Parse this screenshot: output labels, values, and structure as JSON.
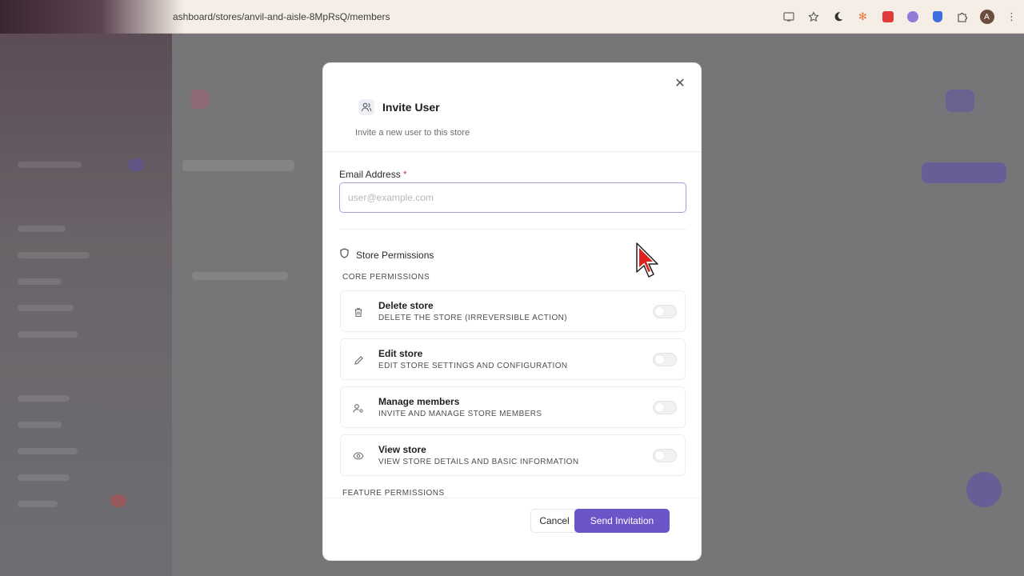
{
  "browser": {
    "url": "ashboard/stores/anvil-and-aisle-8MpRsQ/members",
    "profile_initial": "A",
    "icons": [
      "cast-icon",
      "star-icon",
      "moon-icon",
      "sparkle-icon",
      "download-icon",
      "circle-extension-icon",
      "shield-extension-icon",
      "puzzle-icon",
      "avatar",
      "kebab-menu-icon"
    ]
  },
  "modal": {
    "title": "Invite User",
    "subtitle": "Invite a new user to this store",
    "close_icon": "close-icon",
    "email": {
      "label": "Email Address",
      "required_mark": "*",
      "placeholder": "user@example.com",
      "value": ""
    },
    "permissions": {
      "section_title": "Store Permissions",
      "core_label": "CORE PERMISSIONS",
      "feature_label": "FEATURE PERMISSIONS",
      "core": [
        {
          "title": "Delete store",
          "description": "DELETE THE STORE (IRREVERSIBLE ACTION)",
          "icon": "trash-icon",
          "enabled": false
        },
        {
          "title": "Edit store",
          "description": "EDIT STORE SETTINGS AND CONFIGURATION",
          "icon": "pencil-icon",
          "enabled": false
        },
        {
          "title": "Manage members",
          "description": "INVITE AND MANAGE STORE MEMBERS",
          "icon": "user-cog-icon",
          "enabled": false
        },
        {
          "title": "View store",
          "description": "VIEW STORE DETAILS AND BASIC INFORMATION",
          "icon": "eye-icon",
          "enabled": false
        }
      ]
    },
    "footer": {
      "cancel_label": "Cancel",
      "send_label": "Send Invitation"
    }
  },
  "colors": {
    "accent": "#6b55c9",
    "required": "#d14343",
    "cursor": "#e0201b"
  }
}
